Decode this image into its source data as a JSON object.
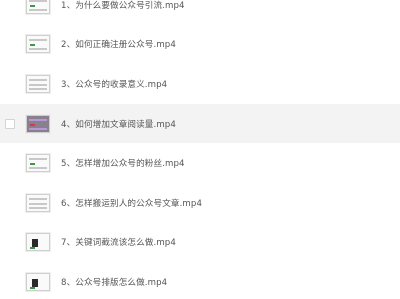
{
  "files": [
    {
      "label": "1、为什么要做公众号引流.mp4",
      "thumb": "plain",
      "selected": false
    },
    {
      "label": "2、如何正确注册公众号.mp4",
      "thumb": "plain",
      "selected": false
    },
    {
      "label": "3、公众号的收录意义.mp4",
      "thumb": "plain",
      "selected": false
    },
    {
      "label": "4、如何增加文章阅读量.mp4",
      "thumb": "dark",
      "selected": true
    },
    {
      "label": "5、怎样增加公众号的粉丝.mp4",
      "thumb": "plain",
      "selected": false
    },
    {
      "label": "6、怎样搬运别人的公众号文章.mp4",
      "thumb": "plain",
      "selected": false
    },
    {
      "label": "7、关键词截流该怎么做.mp4",
      "thumb": "figure",
      "selected": false
    },
    {
      "label": "8、公众号排版怎么做.mp4",
      "thumb": "figure",
      "selected": false
    }
  ]
}
